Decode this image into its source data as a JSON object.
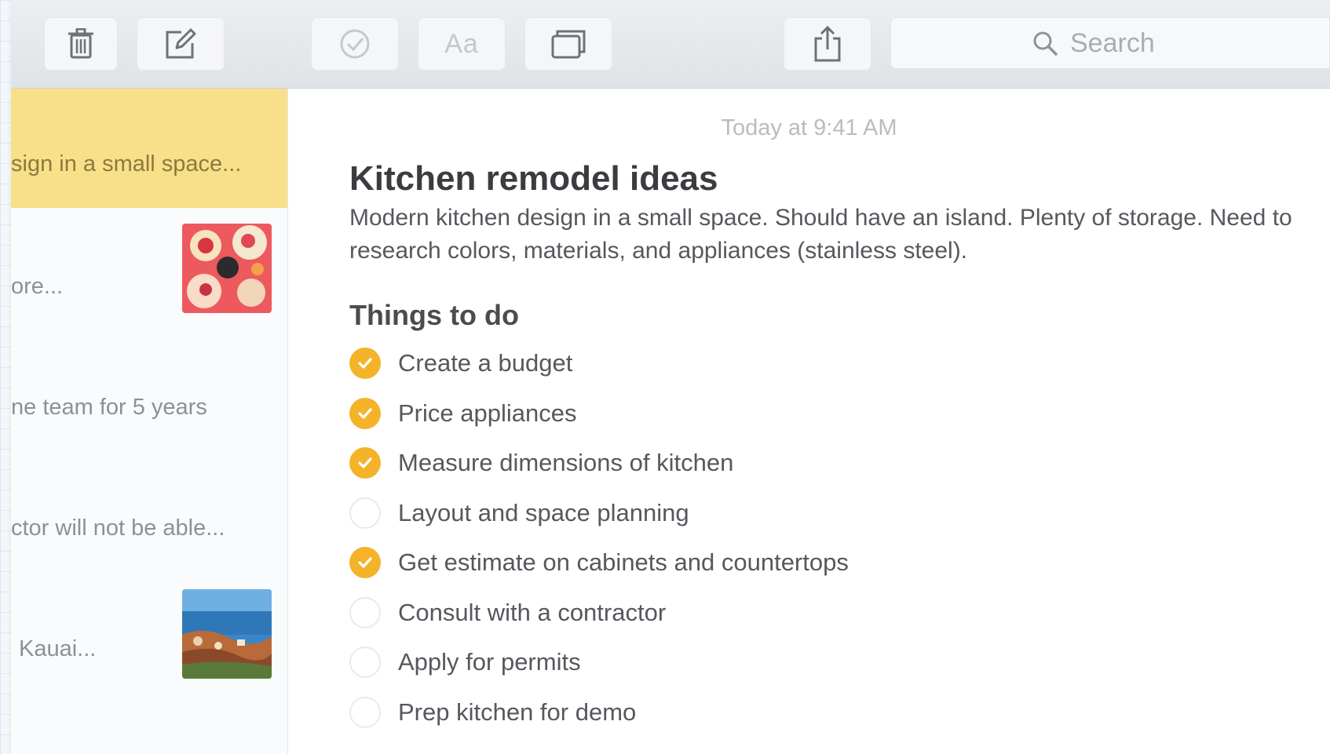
{
  "toolbar": {
    "buttons": [
      {
        "name": "trash",
        "icon": "trash-icon"
      },
      {
        "name": "compose",
        "icon": "compose-icon"
      },
      {
        "name": "checklist",
        "icon": "checklist-icon"
      },
      {
        "name": "format",
        "icon": "format-icon",
        "label": "Aa"
      },
      {
        "name": "attachment",
        "icon": "attachment-icon"
      },
      {
        "name": "share",
        "icon": "share-icon"
      }
    ],
    "search": {
      "placeholder": "Search",
      "icon": "search-icon"
    }
  },
  "note_list": {
    "selected_color": "#f8e08a",
    "items": [
      {
        "snippet": "sign in a small space...",
        "selected": true,
        "thumbnail": null
      },
      {
        "snippet": "ore...",
        "selected": false,
        "thumbnail": "cupcakes-image"
      },
      {
        "snippet": "ne team for 5 years",
        "selected": false,
        "thumbnail": null
      },
      {
        "snippet": "ctor will not be able...",
        "selected": false,
        "thumbnail": null
      },
      {
        "snippet": "Kauai...",
        "selected": false,
        "thumbnail": "coast-image"
      }
    ]
  },
  "note": {
    "timestamp": "Today at 9:41 AM",
    "title": "Kitchen remodel ideas",
    "body": "Modern kitchen design in a small space. Should have an island.  Plenty of storage. Need to research colors, materials, and appliances (stainless steel).",
    "checklist_title": "Things to do",
    "checklist": [
      {
        "label": "Create a budget",
        "checked": true
      },
      {
        "label": "Price appliances",
        "checked": true
      },
      {
        "label": "Measure dimensions of kitchen",
        "checked": true
      },
      {
        "label": "Layout and space planning",
        "checked": false
      },
      {
        "label": "Get estimate on cabinets and countertops",
        "checked": true
      },
      {
        "label": "Consult with a contractor",
        "checked": false
      },
      {
        "label": "Apply for permits",
        "checked": false
      },
      {
        "label": "Prep kitchen for demo",
        "checked": false
      }
    ],
    "check_color": "#f4b329"
  }
}
